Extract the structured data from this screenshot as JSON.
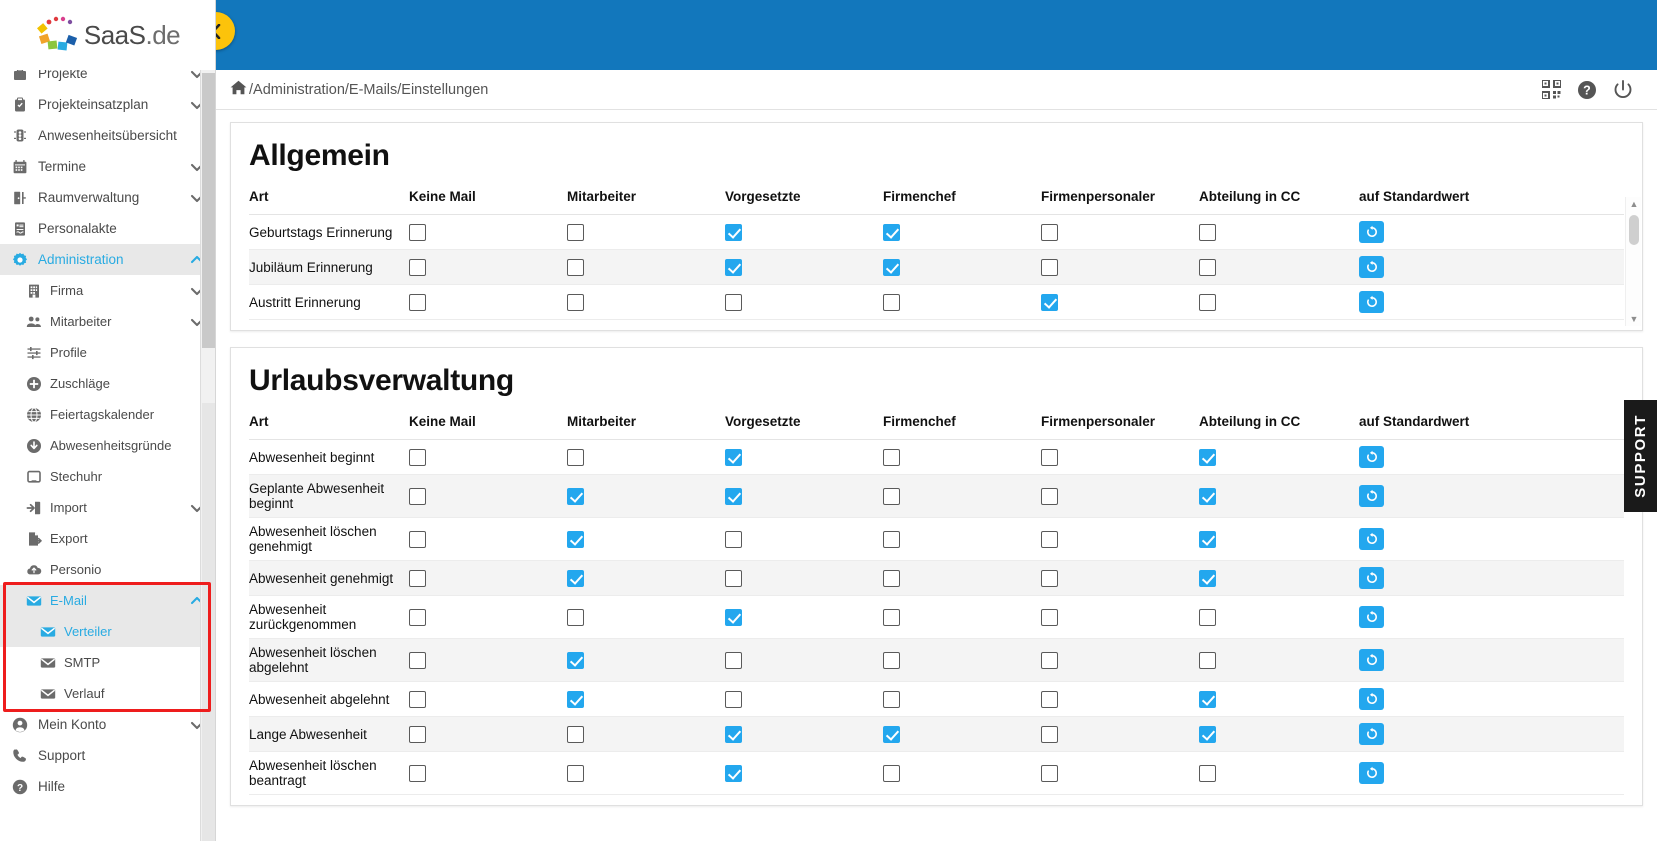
{
  "brand": {
    "name": "SaaS",
    "suffix": ".de"
  },
  "topbar": {
    "collapse_icon": "chevron-left-icon"
  },
  "breadcrumb": {
    "home_icon": "home-icon",
    "path": "/Administration/E-Mails/Einstellungen"
  },
  "header_icons": [
    {
      "name": "qr-code-icon",
      "glyph": "qr"
    },
    {
      "name": "help-icon",
      "glyph": "?"
    },
    {
      "name": "power-icon",
      "glyph": "power"
    }
  ],
  "support_tab": {
    "label": "SUPPORT"
  },
  "sidebar": {
    "items": [
      {
        "label": "Projekte",
        "icon": "briefcase-icon",
        "chevron": "down",
        "level": 0,
        "state": "normal",
        "clipped": true
      },
      {
        "label": "Projekteinsatzplan",
        "icon": "clipboard-icon",
        "chevron": "down",
        "level": 0,
        "state": "normal"
      },
      {
        "label": "Anwesenheitsübersicht",
        "icon": "traffic-light-icon",
        "chevron": "",
        "level": 0,
        "state": "normal"
      },
      {
        "label": "Termine",
        "icon": "calendar-icon",
        "chevron": "down",
        "level": 0,
        "state": "normal"
      },
      {
        "label": "Raumverwaltung",
        "icon": "door-icon",
        "chevron": "down",
        "level": 0,
        "state": "normal"
      },
      {
        "label": "Personalakte",
        "icon": "file-person-icon",
        "chevron": "",
        "level": 0,
        "state": "normal"
      },
      {
        "label": "Administration",
        "icon": "gear-icon",
        "chevron": "up",
        "level": 0,
        "state": "active"
      },
      {
        "label": "Firma",
        "icon": "building-icon",
        "chevron": "down",
        "level": 1,
        "state": "normal"
      },
      {
        "label": "Mitarbeiter",
        "icon": "users-icon",
        "chevron": "down",
        "level": 1,
        "state": "normal"
      },
      {
        "label": "Profile",
        "icon": "sliders-icon",
        "chevron": "",
        "level": 1,
        "state": "normal"
      },
      {
        "label": "Zuschläge",
        "icon": "plus-circle-icon",
        "chevron": "",
        "level": 1,
        "state": "normal"
      },
      {
        "label": "Feiertagskalender",
        "icon": "globe-icon",
        "chevron": "",
        "level": 1,
        "state": "normal"
      },
      {
        "label": "Abwesenheitsgründe",
        "icon": "arrow-down-circle-icon",
        "chevron": "",
        "level": 1,
        "state": "normal"
      },
      {
        "label": "Stechuhr",
        "icon": "tablet-icon",
        "chevron": "",
        "level": 1,
        "state": "normal"
      },
      {
        "label": "Import",
        "icon": "import-icon",
        "chevron": "down",
        "level": 1,
        "state": "normal"
      },
      {
        "label": "Export",
        "icon": "export-icon",
        "chevron": "",
        "level": 1,
        "state": "normal"
      },
      {
        "label": "Personio",
        "icon": "cloud-icon",
        "chevron": "",
        "level": 1,
        "state": "normal"
      },
      {
        "label": "E-Mail",
        "icon": "mail-icon",
        "chevron": "up",
        "level": 1,
        "state": "active"
      },
      {
        "label": "Verteiler",
        "icon": "mail-icon",
        "chevron": "",
        "level": 2,
        "state": "selected"
      },
      {
        "label": "SMTP",
        "icon": "mail-icon",
        "chevron": "",
        "level": 2,
        "state": "normal"
      },
      {
        "label": "Verlauf",
        "icon": "mail-icon",
        "chevron": "",
        "level": 2,
        "state": "normal"
      },
      {
        "label": "Mein Konto",
        "icon": "user-circle-icon",
        "chevron": "down",
        "level": 0,
        "state": "normal"
      },
      {
        "label": "Support",
        "icon": "phone-icon",
        "chevron": "",
        "level": 0,
        "state": "normal"
      },
      {
        "label": "Hilfe",
        "icon": "question-circle-icon",
        "chevron": "",
        "level": 0,
        "state": "normal"
      }
    ],
    "highlight": {
      "color": "#ee1d1d",
      "from_index": 17,
      "to_index": 20
    }
  },
  "colors": {
    "accent": "#23a7ee",
    "topbar": "#1277bc",
    "collapse_button": "#fcc30b",
    "highlight_box": "#ee1d1d",
    "support_tab": "#1a1a1a"
  },
  "sections": [
    {
      "title": "Allgemein",
      "columns": [
        "Art",
        "Keine Mail",
        "Mitarbeiter",
        "Vorgesetzte",
        "Firmenchef",
        "Firmenpersonaler",
        "Abteilung in CC",
        "auf Standardwert"
      ],
      "reset_icon": "reset-icon",
      "rows": [
        {
          "art": "Geburtstags Erinnerung",
          "checks": [
            false,
            false,
            true,
            true,
            false,
            false
          ]
        },
        {
          "art": "Jubiläum Erinnerung",
          "checks": [
            false,
            false,
            true,
            true,
            false,
            false
          ]
        },
        {
          "art": "Austritt Erinnerung",
          "checks": [
            false,
            false,
            false,
            false,
            true,
            false
          ]
        }
      ],
      "scrollable": true
    },
    {
      "title": "Urlaubsverwaltung",
      "columns": [
        "Art",
        "Keine Mail",
        "Mitarbeiter",
        "Vorgesetzte",
        "Firmenchef",
        "Firmenpersonaler",
        "Abteilung in CC",
        "auf Standardwert"
      ],
      "reset_icon": "reset-icon",
      "rows": [
        {
          "art": "Abwesenheit beginnt",
          "checks": [
            false,
            false,
            true,
            false,
            false,
            true
          ]
        },
        {
          "art": "Geplante Abwesenheit beginnt",
          "checks": [
            false,
            true,
            true,
            false,
            false,
            true
          ]
        },
        {
          "art": "Abwesenheit löschen genehmigt",
          "checks": [
            false,
            true,
            false,
            false,
            false,
            true
          ]
        },
        {
          "art": "Abwesenheit genehmigt",
          "checks": [
            false,
            true,
            false,
            false,
            false,
            true
          ]
        },
        {
          "art": "Abwesenheit zurückgenommen",
          "checks": [
            false,
            false,
            true,
            false,
            false,
            false
          ]
        },
        {
          "art": "Abwesenheit löschen abgelehnt",
          "checks": [
            false,
            true,
            false,
            false,
            false,
            false
          ]
        },
        {
          "art": "Abwesenheit abgelehnt",
          "checks": [
            false,
            true,
            false,
            false,
            false,
            true
          ]
        },
        {
          "art": "Lange Abwesenheit",
          "checks": [
            false,
            false,
            true,
            true,
            false,
            true
          ]
        },
        {
          "art": "Abwesenheit löschen beantragt",
          "checks": [
            false,
            false,
            true,
            false,
            false,
            false
          ]
        }
      ],
      "scrollable": false
    }
  ]
}
